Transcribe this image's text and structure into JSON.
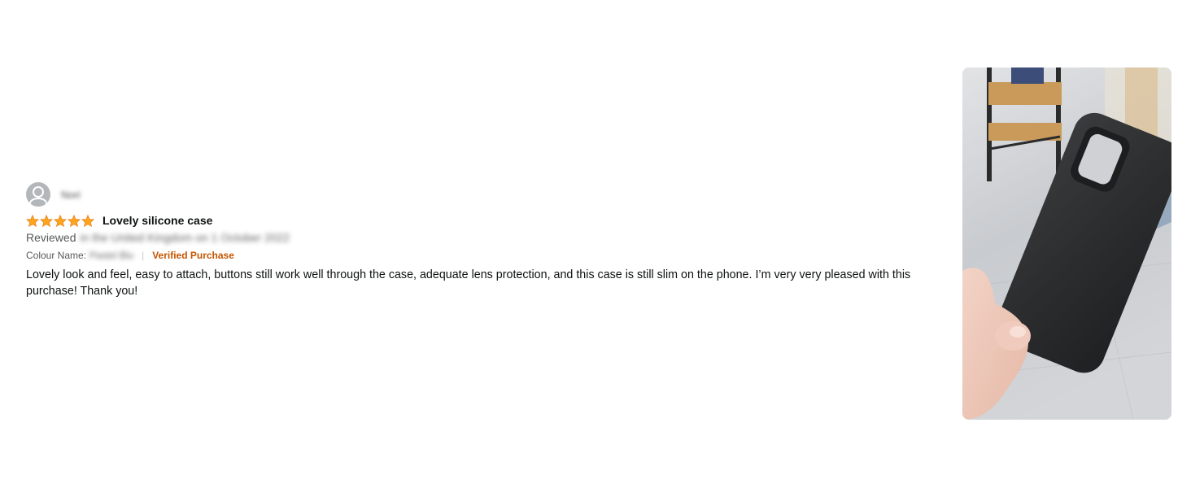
{
  "reviewer": {
    "name": "Nori",
    "avatar_icon": "user-avatar-icon"
  },
  "rating": {
    "stars": 5,
    "max": 5,
    "star_color": "#ffa41c"
  },
  "review": {
    "title": "Lovely silicone case",
    "date_prefix": "Reviewed",
    "date_rest": "in the United Kingdom on 1 October 2022",
    "variant_label": "Colour Name:",
    "variant_value": "Pastel Blu",
    "verified": "Verified Purchase",
    "body": "Lovely look and feel, easy to attach, buttons still work well through the case, adequate lens protection, and this case is still slim on the phone. I’m very very pleased with this purchase! Thank you!"
  },
  "colors": {
    "verified": "#c45500",
    "text": "#0f1111",
    "muted": "#565959"
  },
  "photo": {
    "subject": "hand-holding-black-phone-case"
  }
}
